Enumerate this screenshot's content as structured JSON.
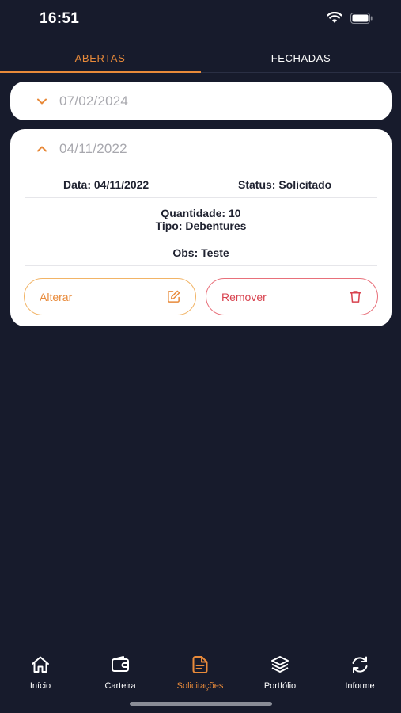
{
  "status_bar": {
    "time": "16:51"
  },
  "tabs": [
    {
      "label": "ABERTAS",
      "active": true
    },
    {
      "label": "FECHADAS",
      "active": false
    }
  ],
  "requests": [
    {
      "date": "07/02/2024",
      "expanded": false
    },
    {
      "date": "04/11/2022",
      "expanded": true,
      "data_line": "Data: 04/11/2022",
      "status_line": "Status: Solicitado",
      "quantity_line": "Quantidade: 10",
      "type_line": "Tipo: Debentures",
      "obs_line": "Obs: Teste",
      "edit_label": "Alterar",
      "remove_label": "Remover"
    }
  ],
  "nav": [
    {
      "label": "Início",
      "icon": "home-icon",
      "active": false
    },
    {
      "label": "Carteira",
      "icon": "wallet-icon",
      "active": false
    },
    {
      "label": "Solicitações",
      "icon": "document-icon",
      "active": true
    },
    {
      "label": "Portfólio",
      "icon": "layers-icon",
      "active": false
    },
    {
      "label": "Informe",
      "icon": "refresh-icon",
      "active": false
    }
  ],
  "colors": {
    "background": "#171b2c",
    "accent": "#e88a3a",
    "danger": "#d8434f",
    "card": "#ffffff"
  }
}
